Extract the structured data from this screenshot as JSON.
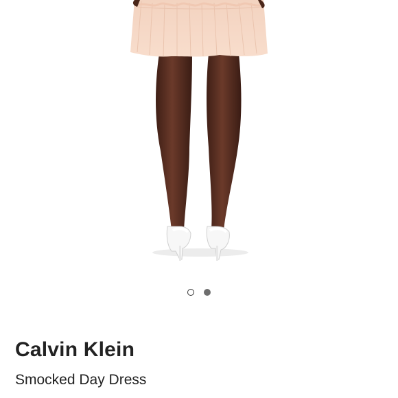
{
  "product": {
    "brand": "Calvin Klein",
    "name": "Smocked Day Dress",
    "image_alt": "Model wearing peach smocked tiered dress with white heeled sandals, back view"
  },
  "carousel": {
    "total": 2,
    "active_index": 1
  },
  "colors": {
    "dress": "#f6d7c4",
    "skin": "#5a2f22",
    "text": "#222222",
    "dot_active": "#6e6e6e"
  }
}
